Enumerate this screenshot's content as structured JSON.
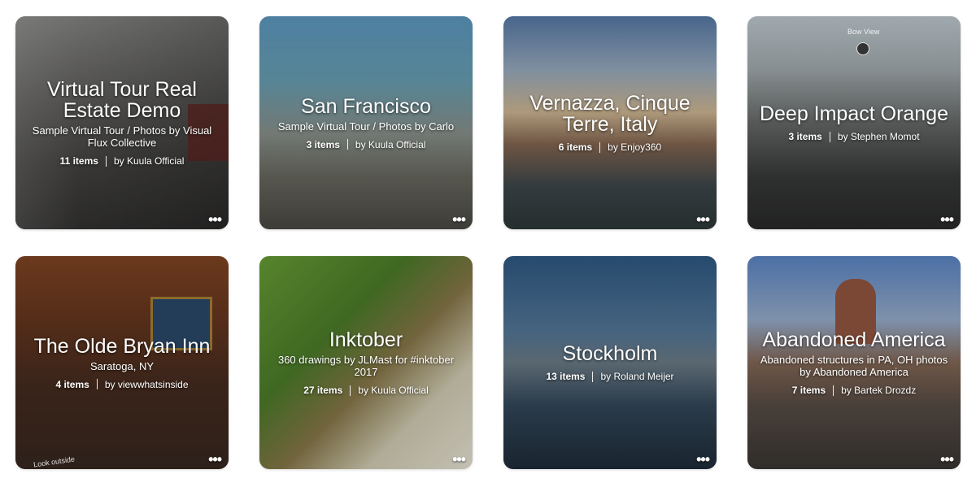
{
  "cards": [
    {
      "title": "Virtual Tour Real Estate Demo",
      "subtitle": "Sample Virtual Tour / Photos by Visual Flux Collective",
      "count": "11 items",
      "author": "by Kuula Official"
    },
    {
      "title": "San Francisco",
      "subtitle": "Sample Virtual Tour / Photos by Carlo",
      "count": "3 items",
      "author": "by Kuula Official"
    },
    {
      "title": "Vernazza, Cinque Terre, Italy",
      "subtitle": "",
      "count": "6 items",
      "author": "by Enjoy360"
    },
    {
      "title": "Deep Impact Orange",
      "subtitle": "",
      "count": "3 items",
      "author": "by Stephen Momot"
    },
    {
      "title": "The Olde Bryan Inn",
      "subtitle": "Saratoga, NY",
      "count": "4 items",
      "author": "by viewwhatsinside"
    },
    {
      "title": "Inktober",
      "subtitle": "360 drawings by JLMast for #inktober 2017",
      "count": "27 items",
      "author": "by Kuula Official"
    },
    {
      "title": "Stockholm",
      "subtitle": "",
      "count": "13 items",
      "author": "by Roland Meijer"
    },
    {
      "title": "Abandoned America",
      "subtitle": "Abandoned structures in PA, OH photos by Abandoned America",
      "count": "7 items",
      "author": "by Bartek Drozdz"
    }
  ],
  "more_label": "•••",
  "deco": {
    "bow_view": "Bow View",
    "look_outside": "Look outside"
  }
}
